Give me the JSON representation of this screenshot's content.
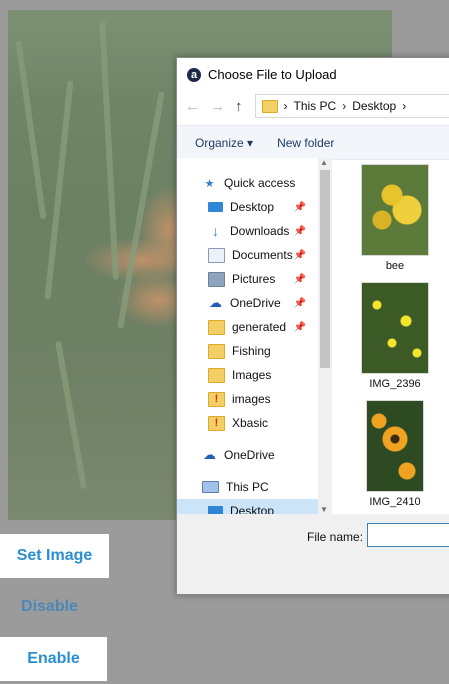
{
  "dialog": {
    "title": "Choose File to Upload",
    "breadcrumb": [
      "This PC",
      "Desktop"
    ],
    "toolbar": {
      "organize": "Organize ▾",
      "new_folder": "New folder"
    },
    "nav_items": [
      {
        "label": "Quick access",
        "icon": "star-icon"
      },
      {
        "label": "Desktop",
        "icon": "desktop-icon"
      },
      {
        "label": "Downloads",
        "icon": "download-icon"
      },
      {
        "label": "Documents",
        "icon": "document-icon"
      },
      {
        "label": "Pictures",
        "icon": "picture-icon"
      },
      {
        "label": "OneDrive",
        "icon": "cloud-icon"
      },
      {
        "label": "generated",
        "icon": "folder-icon"
      },
      {
        "label": "Fishing",
        "icon": "folder-icon"
      },
      {
        "label": "Images",
        "icon": "folder-icon"
      },
      {
        "label": "images",
        "icon": "folder-warning-icon"
      },
      {
        "label": "Xbasic",
        "icon": "folder-warning-icon"
      },
      {
        "label": "OneDrive",
        "icon": "cloud-icon"
      },
      {
        "label": "This PC",
        "icon": "computer-icon"
      },
      {
        "label": "Desktop",
        "icon": "desktop-icon"
      }
    ],
    "files": [
      {
        "label": "bee"
      },
      {
        "label": "IMG_2396"
      },
      {
        "label": "IMG_2410"
      }
    ],
    "file_name_label": "File name:",
    "file_name_value": ""
  },
  "buttons": {
    "set_image": "Set Image",
    "disable": "Disable",
    "enable": "Enable"
  },
  "colors": {
    "accent": "#2a8fd0",
    "overlay": "#9b9b9b"
  }
}
